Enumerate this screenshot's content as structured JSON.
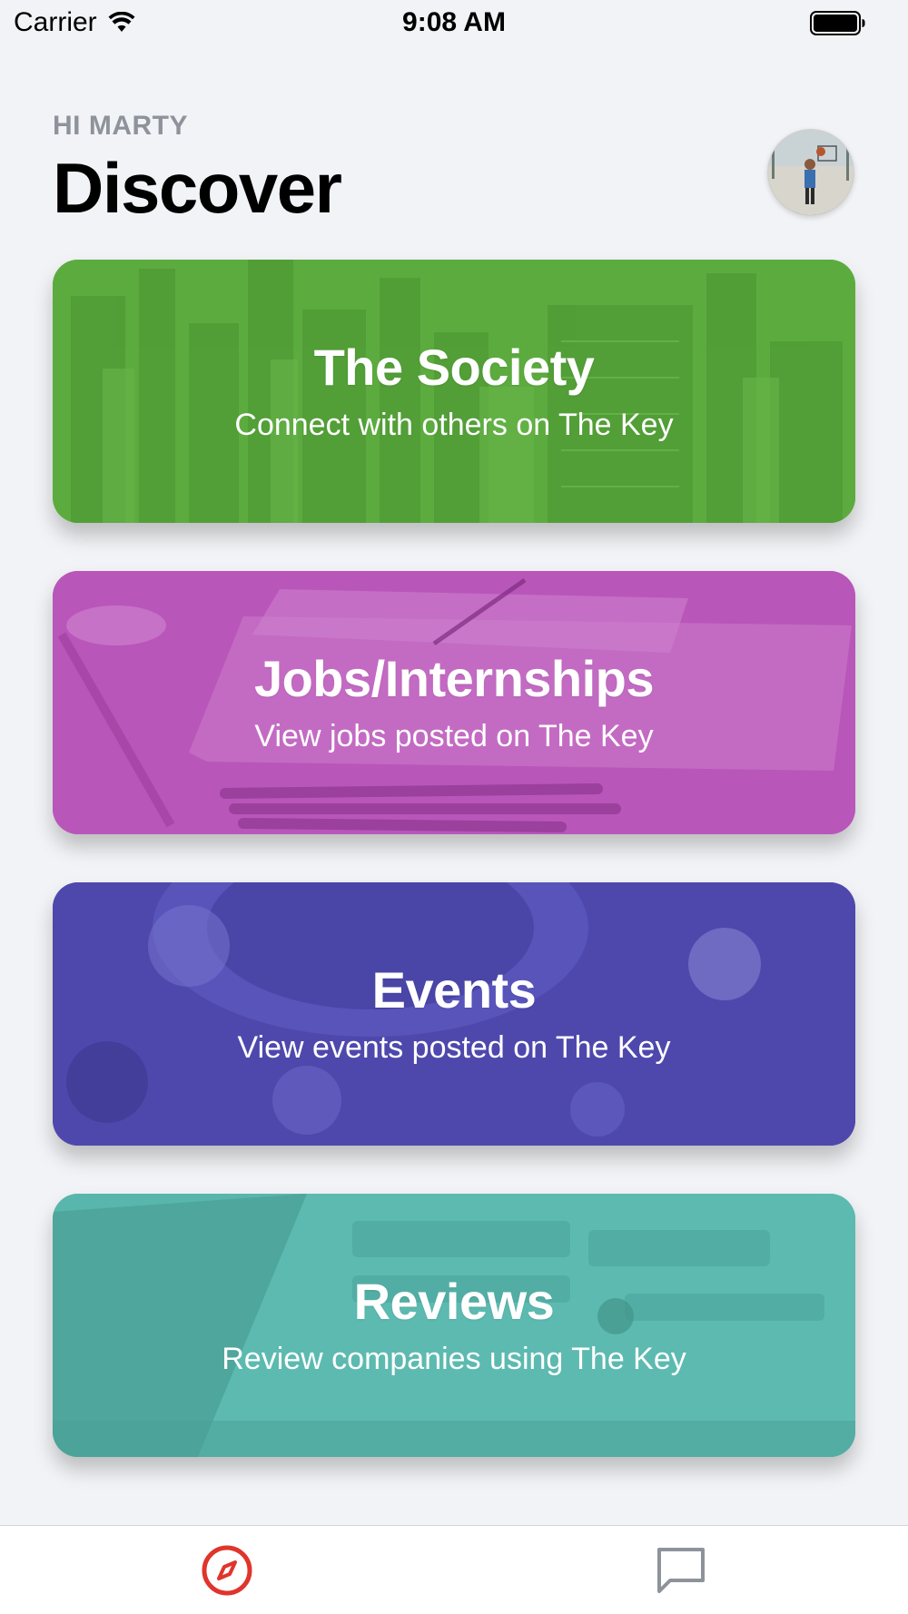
{
  "status_bar": {
    "carrier": "Carrier",
    "time": "9:08 AM"
  },
  "header": {
    "greeting": "HI MARTY",
    "title": "Discover"
  },
  "cards": [
    {
      "title": "The Society",
      "subtitle": "Connect with others on The Key",
      "color": "#5cab3f"
    },
    {
      "title": "Jobs/Internships",
      "subtitle": "View jobs posted on The Key",
      "color": "#b956ba"
    },
    {
      "title": "Events",
      "subtitle": "View events posted on The Key",
      "color": "#4e48ad"
    },
    {
      "title": "Reviews",
      "subtitle": "Review companies using The Key",
      "color": "#58b6ac"
    }
  ],
  "tab_bar": {
    "items": [
      {
        "icon": "compass-icon",
        "active": true,
        "color": "#e0352b"
      },
      {
        "icon": "chat-bubble-icon",
        "active": false,
        "color": "#8e939b"
      }
    ]
  }
}
